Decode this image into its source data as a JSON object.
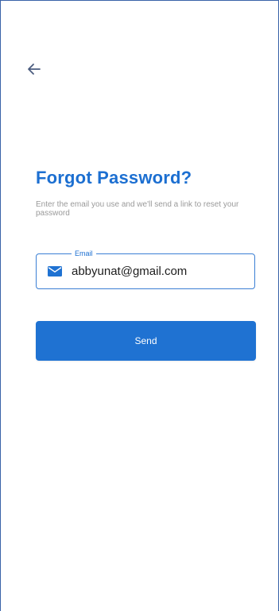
{
  "colors": {
    "accent": "#1c6fd1",
    "button": "#1f72d2",
    "subtitle": "#9a9a9a",
    "frame_border": "#3a62a8"
  },
  "nav": {
    "back_icon": "arrow-left-icon"
  },
  "header": {
    "title": "Forgot Password?",
    "subtitle": "Enter the email you use and we'll send a link to reset your password"
  },
  "form": {
    "email": {
      "label": "Email",
      "icon": "mail-icon",
      "value": "abbyunat@gmail.com"
    },
    "send_label": "Send"
  }
}
